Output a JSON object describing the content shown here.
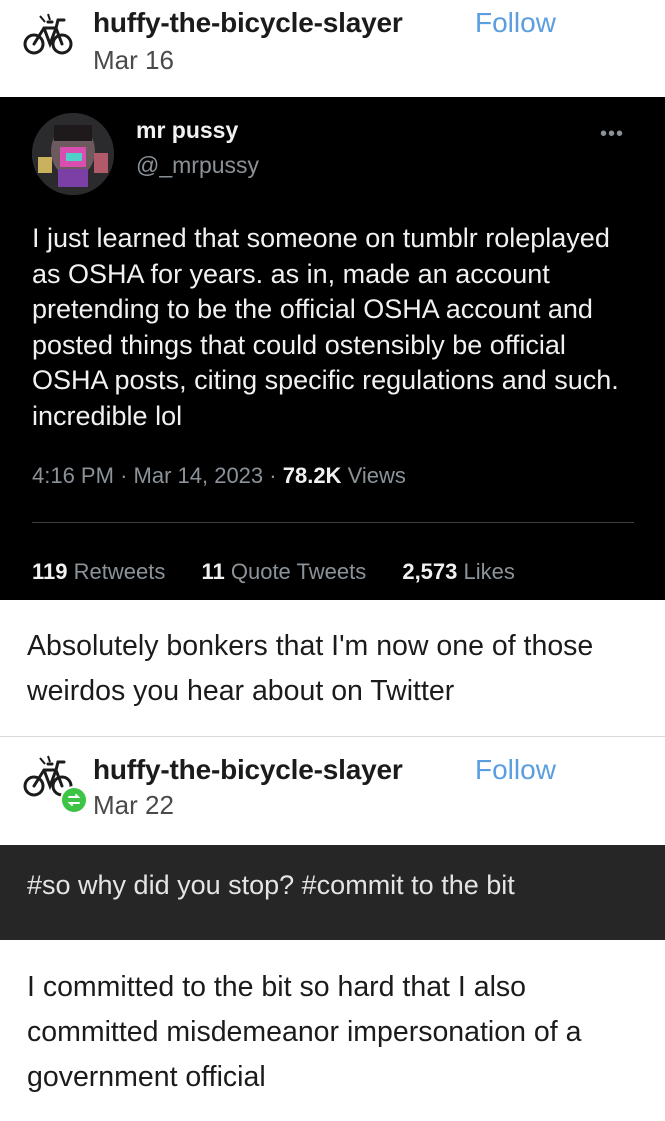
{
  "post1": {
    "username": "huffy-the-bicycle-slayer",
    "follow_label": "Follow",
    "date": "Mar 16"
  },
  "tweet": {
    "display_name": "mr pussy",
    "handle": "@_mrpussy",
    "more_label": "•••",
    "text": "I just learned that someone on tumblr roleplayed as OSHA for years. as in, made an account pretending to be the official OSHA account and posted things that could ostensibly be official OSHA posts, citing specific regulations and such. incredible lol",
    "time": "4:16 PM",
    "date": "Mar 14, 2023",
    "views_count": "78.2K",
    "views_label": "Views",
    "retweets_count": "119",
    "retweets_label": "Retweets",
    "quote_count": "11",
    "quote_label": "Quote Tweets",
    "likes_count": "2,573",
    "likes_label": "Likes"
  },
  "post1_body": "Absolutely bonkers that I'm now one of those weirdos you hear about on Twitter",
  "post2": {
    "username": "huffy-the-bicycle-slayer",
    "follow_label": "Follow",
    "date": "Mar 22"
  },
  "tags_text": "#so why did you stop? #commit to the bit",
  "post2_body": "I committed to the bit so hard that I also committed misdemeanor impersonation of a government official",
  "colors": {
    "follow": "#5b9ee0",
    "tweet_bg": "#000000",
    "tags_bg": "#262626",
    "reblog_badge": "#3ec445"
  },
  "icons": [
    "bicycle-avatar-icon",
    "reblog-icon"
  ]
}
